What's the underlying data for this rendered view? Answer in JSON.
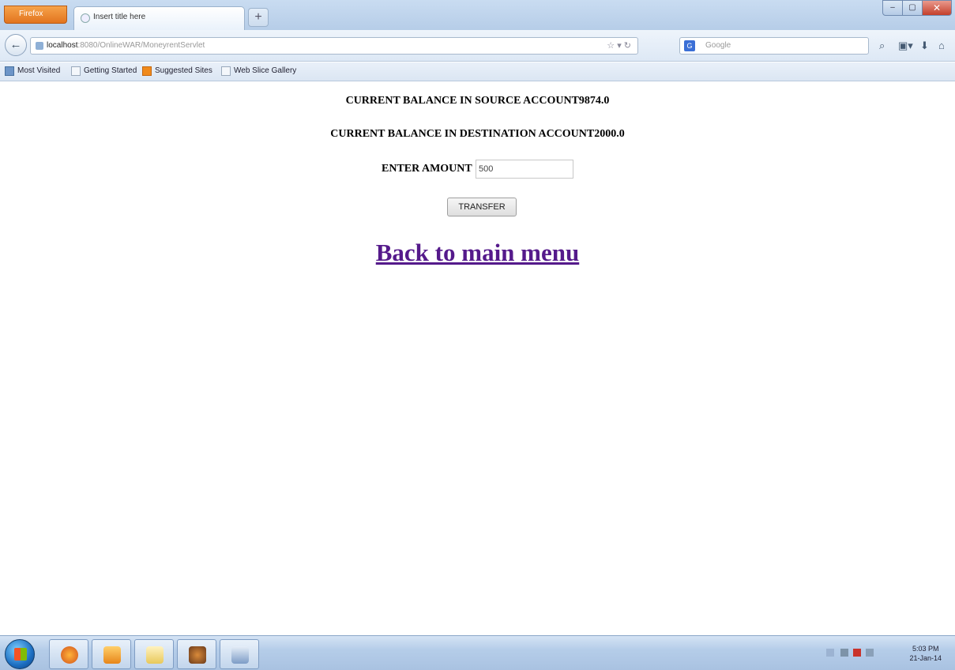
{
  "browser": {
    "menu_button": "Firefox",
    "tab_title": "Insert title here",
    "new_tab": "+",
    "url_host": "localhost",
    "url_rest": ":8080/OnlineWAR/MoneyrentServlet",
    "search_placeholder": "Google",
    "search_engine": "G"
  },
  "bookmarks": [
    {
      "label": "Most Visited"
    },
    {
      "label": "Getting Started"
    },
    {
      "label": "Suggested Sites"
    },
    {
      "label": "Web Slice Gallery"
    }
  ],
  "page": {
    "source_balance": "CURRENT BALANCE IN SOURCE ACCOUNT9874.0",
    "destination_balance": "CURRENT BALANCE IN DESTINATION ACCOUNT2000.0",
    "amount_label": "ENTER AMOUNT",
    "amount_value": "500",
    "transfer_button": "TRANSFER",
    "back_link": "Back to main menu"
  },
  "taskbar": {
    "clock_time": "5:03 PM",
    "clock_date": "21-Jan-14"
  }
}
